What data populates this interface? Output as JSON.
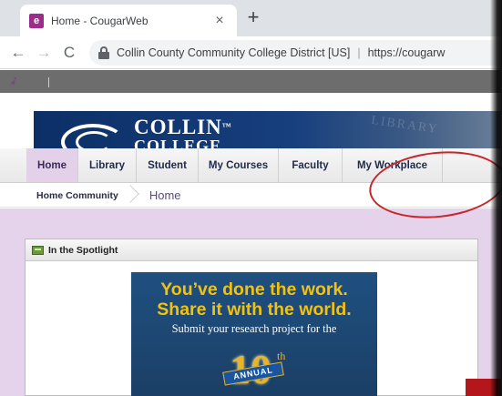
{
  "browser": {
    "tab_favicon": "e",
    "tab_title": "Home - CougarWeb",
    "tab_close": "×",
    "new_tab": "+",
    "back": "←",
    "forward": "→",
    "reload": "C",
    "omnibox_org": "Collin County Community College District [US]",
    "omnibox_sep": "|",
    "omnibox_url": "https://cougarw"
  },
  "banner": {
    "logo_line1": "COLLIN",
    "logo_tm": "™",
    "logo_line2": "COLLEGE",
    "watermark": "LIBRARY"
  },
  "nav": {
    "items": [
      {
        "label": "Home",
        "active": true
      },
      {
        "label": "Library",
        "active": false
      },
      {
        "label": "Student",
        "active": false
      },
      {
        "label": "My Courses",
        "active": false
      },
      {
        "label": "Faculty",
        "active": false
      },
      {
        "label": "My Workplace",
        "active": false
      }
    ]
  },
  "breadcrumb": {
    "community": "Home Community",
    "current": "Home"
  },
  "spotlight": {
    "title": "In the Spotlight"
  },
  "promo": {
    "line1": "You’ve done the work.",
    "line2": "Share it with the world.",
    "line3": "Submit your research project for the",
    "number": "10",
    "suffix": "th",
    "ribbon": "ANNUAL"
  },
  "colors": {
    "active_tab": "#e3d1e9",
    "content_bg": "#e4d3ea",
    "promo_gold": "#f4c20d",
    "annotation_red": "#c8262a"
  }
}
